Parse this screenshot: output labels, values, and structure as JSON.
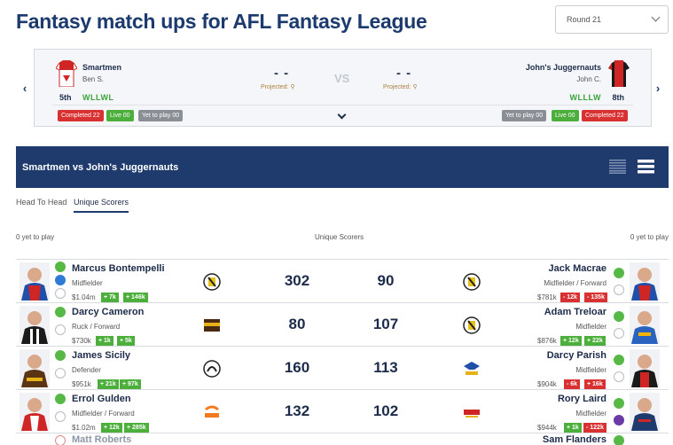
{
  "header": {
    "title": "Fantasy match ups for AFL Fantasy League",
    "round_select": "Round 21"
  },
  "matchup": {
    "home": {
      "team": "Smartmen",
      "coach": "Ben S.",
      "rank": "5th",
      "form": "WLLWL",
      "score": "- -",
      "projected": "Projected:"
    },
    "away": {
      "team": "John's Juggernauts",
      "coach": "John C.",
      "rank": "8th",
      "form": "WLLLW",
      "score": "- -",
      "projected": "Projected:"
    },
    "vs": "VS",
    "home_badges": {
      "completed": "Completed 22",
      "live": "Live 00",
      "yet": "Yet to play 00"
    },
    "away_badges": {
      "yet": "Yet to play 00",
      "live": "Live 00",
      "completed": "Completed 22"
    }
  },
  "banner": {
    "title": "Smartmen vs John's Juggernauts"
  },
  "tabs": {
    "head_to_head": "Head To Head",
    "unique_scorers": "Unique Scorers"
  },
  "section": {
    "left": "0 yet to play",
    "center": "Unique Scorers",
    "right": "0 yet to play"
  },
  "rows": [
    {
      "left": {
        "name": "Marcus Bontempelli",
        "pos": "Midfielder",
        "price": "$1.04m",
        "chip1": "+ 7k",
        "chip2": "+ 146k",
        "club": "RICH",
        "points": "302"
      },
      "right": {
        "name": "Jack Macrae",
        "pos": "Midfielder / Forward",
        "price": "$781k",
        "chip1": "- 12k",
        "chip2": "- 135k",
        "club": "RICH",
        "points": "90"
      }
    },
    {
      "left": {
        "name": "Darcy Cameron",
        "pos": "Ruck / Forward",
        "price": "$730k",
        "chip1": "+ 1k",
        "chip2": "+ 5k",
        "club": "HAWKS",
        "points": "80"
      },
      "right": {
        "name": "Adam Treloar",
        "pos": "Midfielder",
        "price": "$876k",
        "chip1": "+ 12k",
        "chip2": "+ 22k",
        "club": "RICH",
        "points": "107"
      }
    },
    {
      "left": {
        "name": "James Sicily",
        "pos": "Defender",
        "price": "$951k",
        "chip1": "+ 21k",
        "chip2": "+ 97k",
        "club": "COLL",
        "points": "160"
      },
      "right": {
        "name": "Darcy Parish",
        "pos": "Midfielder",
        "price": "$904k",
        "chip1": "- 6k",
        "chip2": "+ 16k",
        "club": "EAGLES",
        "points": "113"
      }
    },
    {
      "left": {
        "name": "Errol Gulden",
        "pos": "Midfielder / Forward",
        "price": "$1.02m",
        "chip1": "+ 12k",
        "chip2": "+ 285k",
        "club": "GIANTS",
        "points": "132"
      },
      "right": {
        "name": "Rory Laird",
        "pos": "Midfielder",
        "price": "$944k",
        "chip1": "+ 1k",
        "chip2": "- 122k",
        "club": "SUNS",
        "points": "102"
      }
    },
    {
      "left": {
        "name": "Matt Roberts"
      },
      "right": {
        "name": "Sam Flanders"
      }
    }
  ],
  "colors": {
    "navy": "#1f3b6d",
    "green": "#4cae3b",
    "red": "#d93131",
    "grey": "#8a8f96"
  }
}
